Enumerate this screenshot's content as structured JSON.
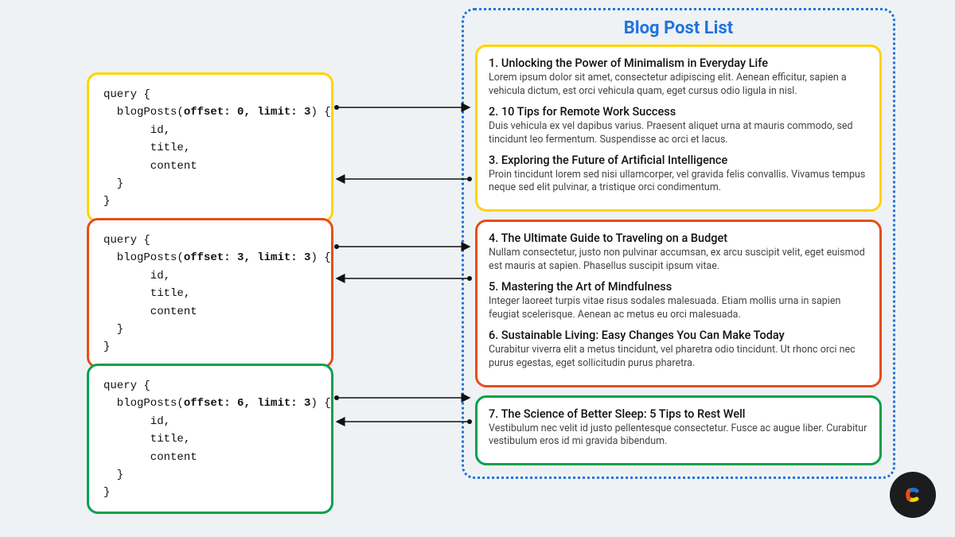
{
  "queries": [
    {
      "color": "yellow",
      "text_pre": "query {\n  blogPosts(",
      "args": "offset: 0, limit: 3",
      "text_post": ") {\n       id,\n       title,\n       content\n  }\n}"
    },
    {
      "color": "red",
      "text_pre": "query {\n  blogPosts(",
      "args": "offset: 3, limit: 3",
      "text_post": ") {\n       id,\n       title,\n       content\n  }\n}"
    },
    {
      "color": "green",
      "text_pre": "query {\n  blogPosts(",
      "args": "offset: 6, limit: 3",
      "text_post": ") {\n       id,\n       title,\n       content\n  }\n}"
    }
  ],
  "blog": {
    "title": "Blog Post List",
    "groups": [
      {
        "posts": [
          {
            "n": "1.",
            "title": "Unlocking the Power of Minimalism in Everyday Life",
            "body": "Lorem ipsum dolor sit amet, consectetur adipiscing elit. Aenean efficitur, sapien a vehicula dictum, est orci vehicula quam, eget cursus odio ligula in nisl."
          },
          {
            "n": "2.",
            "title": "10 Tips for Remote Work Success",
            "body": "Duis vehicula ex vel dapibus varius. Praesent aliquet urna at mauris commodo, sed tincidunt leo fermentum. Suspendisse ac orci et lacus."
          },
          {
            "n": "3.",
            "title": "Exploring the Future of Artificial Intelligence",
            "body": "Proin tincidunt lorem sed nisi ullamcorper, vel gravida felis convallis. Vivamus tempus neque sed elit pulvinar, a tristique orci condimentum."
          }
        ]
      },
      {
        "posts": [
          {
            "n": "4.",
            "title": "The Ultimate Guide to Traveling on a Budget",
            "body": "Nullam consectetur, justo non pulvinar accumsan, ex arcu suscipit velit, eget euismod est mauris at sapien. Phasellus suscipit ipsum vitae."
          },
          {
            "n": "5.",
            "title": "Mastering the Art of Mindfulness",
            "body": "Integer laoreet turpis vitae risus sodales malesuada. Etiam mollis urna in sapien feugiat scelerisque. Aenean ac metus eu orci malesuada."
          },
          {
            "n": "6.",
            "title": "Sustainable Living: Easy Changes You Can Make Today",
            "body": "Curabitur viverra elit a metus tincidunt, vel pharetra odio tincidunt. Ut rhonc orci nec purus egestas, eget sollicitudin purus pharetra."
          }
        ]
      },
      {
        "posts": [
          {
            "n": "7.",
            "title": "The Science of Better Sleep: 5 Tips to Rest Well",
            "body": "Vestibulum nec velit id justo pellentesque consectetur. Fusce ac augue liber. Curabitur vestibulum eros id mi gravida bibendum."
          }
        ]
      }
    ]
  }
}
